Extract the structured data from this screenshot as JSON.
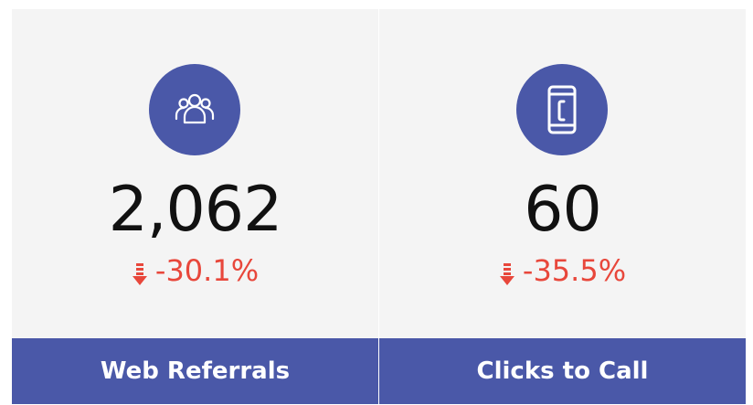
{
  "colors": {
    "card_background": "#f4f4f4",
    "accent": "#4a58a8",
    "negative": "#e8473b",
    "value_text": "#111111"
  },
  "cards": [
    {
      "icon": "people-group-icon",
      "value": "2,062",
      "change": "-30.1%",
      "change_direction": "down",
      "label": "Web Referrals"
    },
    {
      "icon": "mobile-phone-icon",
      "value": "60",
      "change": "-35.5%",
      "change_direction": "down",
      "label": "Clicks to Call"
    }
  ]
}
